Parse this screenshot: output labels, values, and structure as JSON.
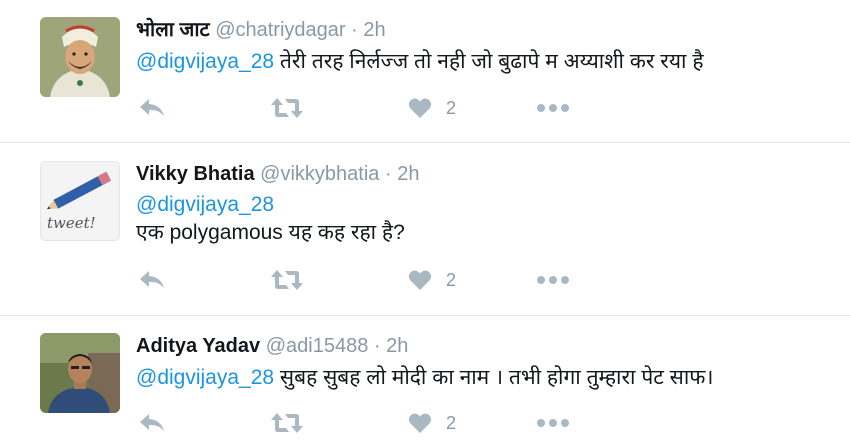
{
  "tweets": [
    {
      "name": "भोला जाट",
      "handle": "@chatriydagar",
      "separator": "·",
      "time": "2h",
      "mention": "@digvijaya_28",
      "text": " तेरी तरह निर्लज्ज तो नही जो बुढापे म अय्याशी कर रया है",
      "likes": "2",
      "avatar": "portrait-painting"
    },
    {
      "name": "Vikky Bhatia",
      "handle": "@vikkybhatia",
      "separator": "·",
      "time": "2h",
      "mention": "@digvijaya_28",
      "text": "एक polygamous यह कह रहा है?",
      "likes": "2",
      "avatar": "tweet-pencil",
      "avatar_text": "tweet!"
    },
    {
      "name": "Aditya Yadav",
      "handle": "@adi15488",
      "separator": "·",
      "time": "2h",
      "mention": "@digvijaya_28",
      "text": " सुबह सुबह  लो मोदी का नाम । तभी होगा तुम्हारा पेट साफ।",
      "likes": "2",
      "avatar": "man-photo"
    }
  ],
  "icons": [
    "reply-icon",
    "retweet-icon",
    "heart-icon",
    "more-icon"
  ],
  "colors": {
    "link": "#1b95e0",
    "muted": "#8899a6",
    "action": "#aab8c2",
    "divider": "#e1e8ed"
  }
}
